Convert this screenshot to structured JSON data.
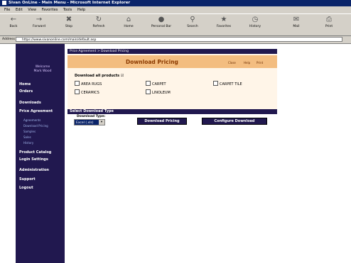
{
  "window": {
    "title": "Sivan OnLine - Main Menu - Microsoft Internet Explorer"
  },
  "menu": [
    "File",
    "Edit",
    "View",
    "Favorites",
    "Tools",
    "Help"
  ],
  "toolbar": [
    {
      "label": "Back",
      "icon": "back-arrow-icon"
    },
    {
      "label": "Forward",
      "icon": "forward-arrow-icon"
    },
    {
      "label": "Stop",
      "icon": "stop-icon"
    },
    {
      "label": "Refresh",
      "icon": "refresh-icon"
    },
    {
      "label": "Home",
      "icon": "home-icon"
    },
    {
      "label": "Personal Bar",
      "icon": "personal-bar-icon"
    },
    {
      "label": "Search",
      "icon": "search-icon"
    },
    {
      "label": "Favorites",
      "icon": "favorites-icon"
    },
    {
      "label": "History",
      "icon": "history-icon"
    },
    {
      "label": "Mail",
      "icon": "mail-icon"
    },
    {
      "label": "Print",
      "icon": "print-icon"
    }
  ],
  "address": {
    "label": "Address",
    "url": "https://www.sivanonline.com/main/default.asp"
  },
  "sidebar": {
    "greeting": [
      "Welcome",
      "Mark Wood"
    ],
    "nav": [
      "Home",
      "Orders",
      "Downloads",
      "Price Agreement",
      "Product Catalog",
      "Login Settings",
      "Administration",
      "Support",
      "Logout"
    ],
    "subnav": [
      "Agreements",
      "Download Pricing",
      "Samples",
      "Sales",
      "History"
    ]
  },
  "breadcrumb": "Price Agreement > Download Pricing",
  "download": {
    "title": "Download Pricing",
    "header_links": [
      "Close",
      "Help",
      "Print"
    ],
    "products_label": "Download all products",
    "products": [
      "AREA RUGS",
      "CARPET",
      "CARPET TILE",
      "CERAMICS",
      "LINOLEUM"
    ]
  },
  "select_type": {
    "header": "Select Download Type",
    "label": "Download Type:",
    "selected": "Excel (.xls)",
    "buttons": [
      "Download Pricing",
      "Configure Download"
    ]
  }
}
